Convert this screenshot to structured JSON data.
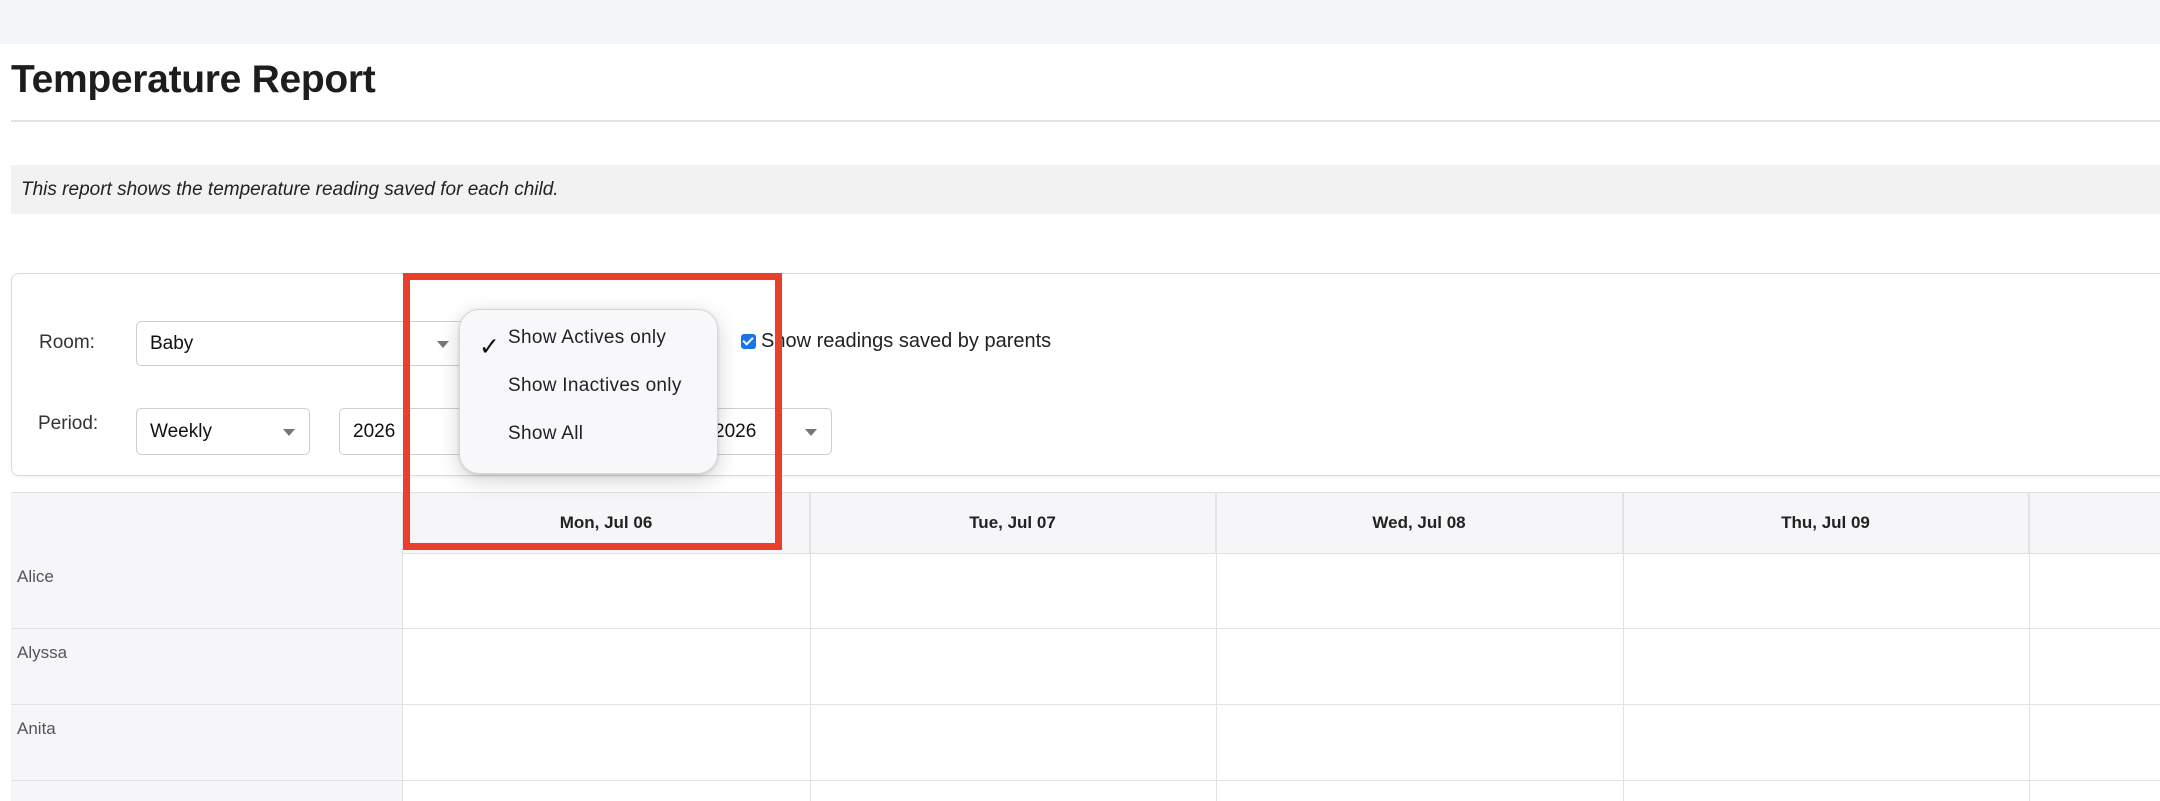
{
  "page": {
    "title": "Temperature Report",
    "description": "This report shows the temperature reading saved for each child."
  },
  "filters": {
    "room_label": "Room:",
    "room_value": "Baby",
    "period_label": "Period:",
    "period_value": "Weekly",
    "year_value": "2026",
    "year_end_value": "2026",
    "show_parents_label": "Show readings saved by parents",
    "show_parents_checked": true
  },
  "status_menu": {
    "options": [
      {
        "label": "Show Actives only",
        "selected": true
      },
      {
        "label": "Show Inactives only",
        "selected": false
      },
      {
        "label": "Show All",
        "selected": false
      }
    ]
  },
  "table": {
    "columns": [
      "Mon, Jul 06",
      "Tue, Jul 07",
      "Wed, Jul 08",
      "Thu, Jul 09"
    ],
    "rows": [
      {
        "name": "Alice"
      },
      {
        "name": "Alyssa"
      },
      {
        "name": "Anita"
      }
    ]
  },
  "colors": {
    "highlight": "#ea3f2c",
    "checkbox": "#1a73e8"
  }
}
